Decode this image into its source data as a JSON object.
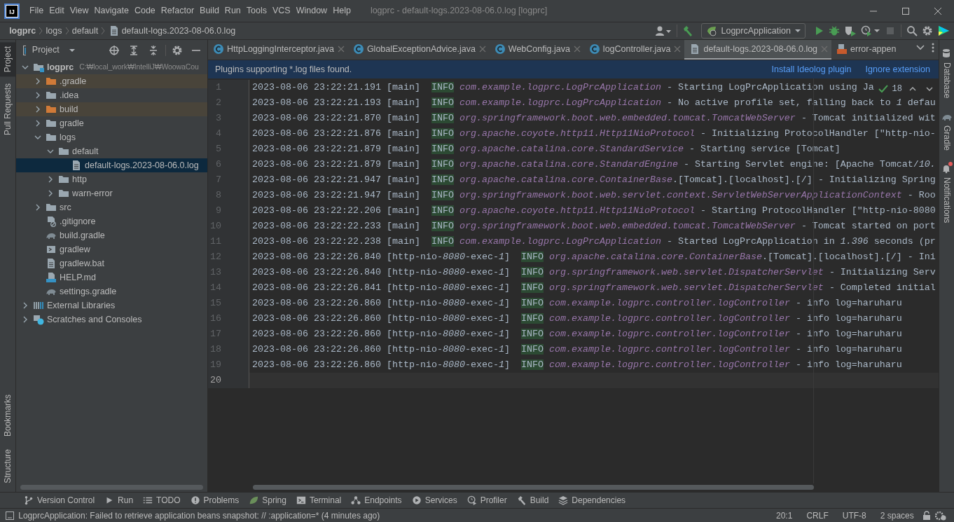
{
  "app_logo": {
    "text": "IJ"
  },
  "menus": [
    {
      "label": "File"
    },
    {
      "label": "Edit"
    },
    {
      "label": "View"
    },
    {
      "label": "Navigate"
    },
    {
      "label": "Code"
    },
    {
      "label": "Refactor"
    },
    {
      "label": "Build"
    },
    {
      "label": "Run"
    },
    {
      "label": "Tools"
    },
    {
      "label": "VCS"
    },
    {
      "label": "Window"
    },
    {
      "label": "Help"
    }
  ],
  "window": {
    "title": "logprc - default-logs.2023-08-06.0.log [logprc]"
  },
  "breadcrumbs": [
    {
      "label": "logprc",
      "kind": "project"
    },
    {
      "label": "logs",
      "kind": "folder"
    },
    {
      "label": "default",
      "kind": "folder"
    },
    {
      "label": "default-logs.2023-08-06.0.log",
      "kind": "file"
    }
  ],
  "run_configuration": {
    "label": "LogprcApplication"
  },
  "left_tool_tabs_top": [
    {
      "label": "Project",
      "selected": true
    },
    {
      "label": "Pull Requests",
      "selected": false
    }
  ],
  "left_tool_tabs_bottom": [
    {
      "label": "Bookmarks",
      "selected": false
    },
    {
      "label": "Structure",
      "selected": false
    }
  ],
  "project_panel": {
    "title": "Project",
    "tree": [
      {
        "label": "logprc",
        "kind": "module",
        "path": "C:₩local_work₩IntelliJ₩WoowaCou",
        "expanded": true,
        "excluded": false,
        "selected": false,
        "children": [
          {
            "label": ".gradle",
            "kind": "folder",
            "expanded": false,
            "excluded": true,
            "selected": false
          },
          {
            "label": ".idea",
            "kind": "folder",
            "expanded": false,
            "excluded": false,
            "selected": false
          },
          {
            "label": "build",
            "kind": "folder",
            "expanded": false,
            "excluded": true,
            "selected": false
          },
          {
            "label": "gradle",
            "kind": "folder",
            "expanded": false,
            "excluded": false,
            "selected": false
          },
          {
            "label": "logs",
            "kind": "folder",
            "expanded": true,
            "excluded": false,
            "selected": false,
            "children": [
              {
                "label": "default",
                "kind": "folder",
                "expanded": true,
                "excluded": false,
                "selected": false,
                "children": [
                  {
                    "label": "default-logs.2023-08-06.0.log",
                    "kind": "file",
                    "excluded": false,
                    "selected": true
                  }
                ]
              },
              {
                "label": "http",
                "kind": "folder",
                "expanded": false,
                "excluded": false,
                "selected": false
              },
              {
                "label": "warn-error",
                "kind": "folder",
                "expanded": false,
                "excluded": false,
                "selected": false
              }
            ]
          },
          {
            "label": "src",
            "kind": "folder",
            "expanded": false,
            "excluded": false,
            "selected": false
          },
          {
            "label": ".gitignore",
            "kind": "gitignore",
            "excluded": false,
            "selected": false
          },
          {
            "label": "build.gradle",
            "kind": "gradle",
            "excluded": false,
            "selected": false
          },
          {
            "label": "gradlew",
            "kind": "script",
            "excluded": false,
            "selected": false
          },
          {
            "label": "gradlew.bat",
            "kind": "file",
            "excluded": false,
            "selected": false
          },
          {
            "label": "HELP.md",
            "kind": "markdown",
            "excluded": false,
            "selected": false
          },
          {
            "label": "settings.gradle",
            "kind": "gradle",
            "excluded": false,
            "selected": false
          }
        ]
      },
      {
        "label": "External Libraries",
        "kind": "libraries",
        "expanded": false,
        "excluded": false,
        "selected": false
      },
      {
        "label": "Scratches and Consoles",
        "kind": "scratches",
        "expanded": false,
        "excluded": false,
        "selected": false
      }
    ]
  },
  "editor_tabs": [
    {
      "label": "HttpLoggingInterceptor.java",
      "kind": "java",
      "selected": false
    },
    {
      "label": "GlobalExceptionAdvice.java",
      "kind": "java",
      "selected": false
    },
    {
      "label": "WebConfig.java",
      "kind": "java",
      "selected": false
    },
    {
      "label": "logController.java",
      "kind": "java",
      "selected": false
    },
    {
      "label": "default-logs.2023-08-06.0.log",
      "kind": "log",
      "selected": true
    },
    {
      "label": "error-appen",
      "kind": "xml",
      "selected": false
    }
  ],
  "banner": {
    "text": "Plugins supporting *.log files found.",
    "links": [
      "Install Ideolog plugin",
      "Ignore extension"
    ]
  },
  "inspection": {
    "count": "18"
  },
  "editor": {
    "lines": [
      {
        "number": "1",
        "current": false,
        "time": "2023-08-06 23:22:21.191",
        "thread": "[main]",
        "level": "INFO",
        "logger": "com.example.logprc.LogPrcApplication",
        "message": "- Starting LogPrcApplication using Ja"
      },
      {
        "number": "2",
        "current": false,
        "time": "2023-08-06 23:22:21.193",
        "thread": "[main]",
        "level": "INFO",
        "logger": "com.example.logprc.LogPrcApplication",
        "message": "- No active profile set, falling back to *1* defau"
      },
      {
        "number": "3",
        "current": false,
        "time": "2023-08-06 23:22:21.870",
        "thread": "[main]",
        "level": "INFO",
        "logger": "org.springframework.boot.web.embedded.tomcat.TomcatWebServer",
        "message": "- Tomcat initialized wit"
      },
      {
        "number": "4",
        "current": false,
        "time": "2023-08-06 23:22:21.876",
        "thread": "[main]",
        "level": "INFO",
        "logger": "org.apache.coyote.http11.Http11NioProtocol",
        "message": "- Initializing ProtocolHandler [\"http-nio-"
      },
      {
        "number": "5",
        "current": false,
        "time": "2023-08-06 23:22:21.879",
        "thread": "[main]",
        "level": "INFO",
        "logger": "org.apache.catalina.core.StandardService",
        "message": "- Starting service [Tomcat]"
      },
      {
        "number": "6",
        "current": false,
        "time": "2023-08-06 23:22:21.879",
        "thread": "[main]",
        "level": "INFO",
        "logger": "org.apache.catalina.core.StandardEngine",
        "message": "- Starting Servlet engine: [Apache Tomcat/*10.*"
      },
      {
        "number": "7",
        "current": false,
        "time": "2023-08-06 23:22:21.947",
        "thread": "[main]",
        "level": "INFO",
        "logger": "org.apache.catalina.core.ContainerBase",
        "logger_tail": ".[Tomcat].[localhost].[/]",
        "message": "- Initializing Spring"
      },
      {
        "number": "8",
        "current": false,
        "time": "2023-08-06 23:22:21.947",
        "thread": "[main]",
        "level": "INFO",
        "logger": "org.springframework.boot.web.servlet.context.ServletWebServerApplicationContext",
        "message": "- Roo"
      },
      {
        "number": "9",
        "current": false,
        "time": "2023-08-06 23:22:22.206",
        "thread": "[main]",
        "level": "INFO",
        "logger": "org.apache.coyote.http11.Http11NioProtocol",
        "message": "- Starting ProtocolHandler [\"http-nio-8080"
      },
      {
        "number": "10",
        "current": false,
        "time": "2023-08-06 23:22:22.233",
        "thread": "[main]",
        "level": "INFO",
        "logger": "org.springframework.boot.web.embedded.tomcat.TomcatWebServer",
        "message": "- Tomcat started on port"
      },
      {
        "number": "11",
        "current": false,
        "time": "2023-08-06 23:22:22.238",
        "thread": "[main]",
        "level": "INFO",
        "logger": "com.example.logprc.LogPrcApplication",
        "message": "- Started LogPrcApplication in *1.396* seconds (pr"
      },
      {
        "number": "12",
        "current": false,
        "time": "2023-08-06 23:22:26.840",
        "thread": "[http-nio-*8080*-exec-*1*]",
        "level": "INFO",
        "logger": "org.apache.catalina.core.ContainerBase",
        "logger_tail": ".[Tomcat].[localhost].[/]",
        "message": "- Ini"
      },
      {
        "number": "13",
        "current": false,
        "time": "2023-08-06 23:22:26.840",
        "thread": "[http-nio-*8080*-exec-*1*]",
        "level": "INFO",
        "logger": "org.springframework.web.servlet.DispatcherServlet",
        "message": "- Initializing Serv"
      },
      {
        "number": "14",
        "current": false,
        "time": "2023-08-06 23:22:26.841",
        "thread": "[http-nio-*8080*-exec-*1*]",
        "level": "INFO",
        "logger": "org.springframework.web.servlet.DispatcherServlet",
        "message": "- Completed initial"
      },
      {
        "number": "15",
        "current": false,
        "time": "2023-08-06 23:22:26.860",
        "thread": "[http-nio-*8080*-exec-*1*]",
        "level": "INFO",
        "logger": "com.example.logprc.controller.logController",
        "message": "- info log=haruharu"
      },
      {
        "number": "16",
        "current": false,
        "time": "2023-08-06 23:22:26.860",
        "thread": "[http-nio-*8080*-exec-*1*]",
        "level": "INFO",
        "logger": "com.example.logprc.controller.logController",
        "message": "- info log=haruharu"
      },
      {
        "number": "17",
        "current": false,
        "time": "2023-08-06 23:22:26.860",
        "thread": "[http-nio-*8080*-exec-*1*]",
        "level": "INFO",
        "logger": "com.example.logprc.controller.logController",
        "message": "- info log=haruharu"
      },
      {
        "number": "18",
        "current": false,
        "time": "2023-08-06 23:22:26.860",
        "thread": "[http-nio-*8080*-exec-*1*]",
        "level": "INFO",
        "logger": "com.example.logprc.controller.logController",
        "message": "- info log=haruharu"
      },
      {
        "number": "19",
        "current": false,
        "time": "2023-08-06 23:22:26.860",
        "thread": "[http-nio-*8080*-exec-*1*]",
        "level": "INFO",
        "logger": "com.example.logprc.controller.logController",
        "message": "- info log=haruharu"
      },
      {
        "number": "20",
        "current": true
      }
    ]
  },
  "right_tool_tabs": [
    {
      "label": "Database",
      "kind": "database",
      "unread": false
    },
    {
      "label": "Gradle",
      "kind": "gradle",
      "unread": false
    },
    {
      "label": "Notifications",
      "kind": "bell",
      "unread": true
    }
  ],
  "bottom_tools": [
    {
      "label": "Version Control",
      "kind": "vcs"
    },
    {
      "label": "Run",
      "kind": "run"
    },
    {
      "label": "TODO",
      "kind": "todo"
    },
    {
      "label": "Problems",
      "kind": "problems"
    },
    {
      "label": "Spring",
      "kind": "spring"
    },
    {
      "label": "Terminal",
      "kind": "terminal"
    },
    {
      "label": "Endpoints",
      "kind": "endpoints"
    },
    {
      "label": "Services",
      "kind": "services"
    },
    {
      "label": "Profiler",
      "kind": "profiler"
    },
    {
      "label": "Build",
      "kind": "build"
    },
    {
      "label": "Dependencies",
      "kind": "dependencies"
    }
  ],
  "status_bar": {
    "message": "LogprcApplication: Failed to retrieve application beans snapshot: // :application=* (4 minutes ago)",
    "items": [
      "20:1",
      "CRLF",
      "UTF-8",
      "2 spaces"
    ]
  }
}
